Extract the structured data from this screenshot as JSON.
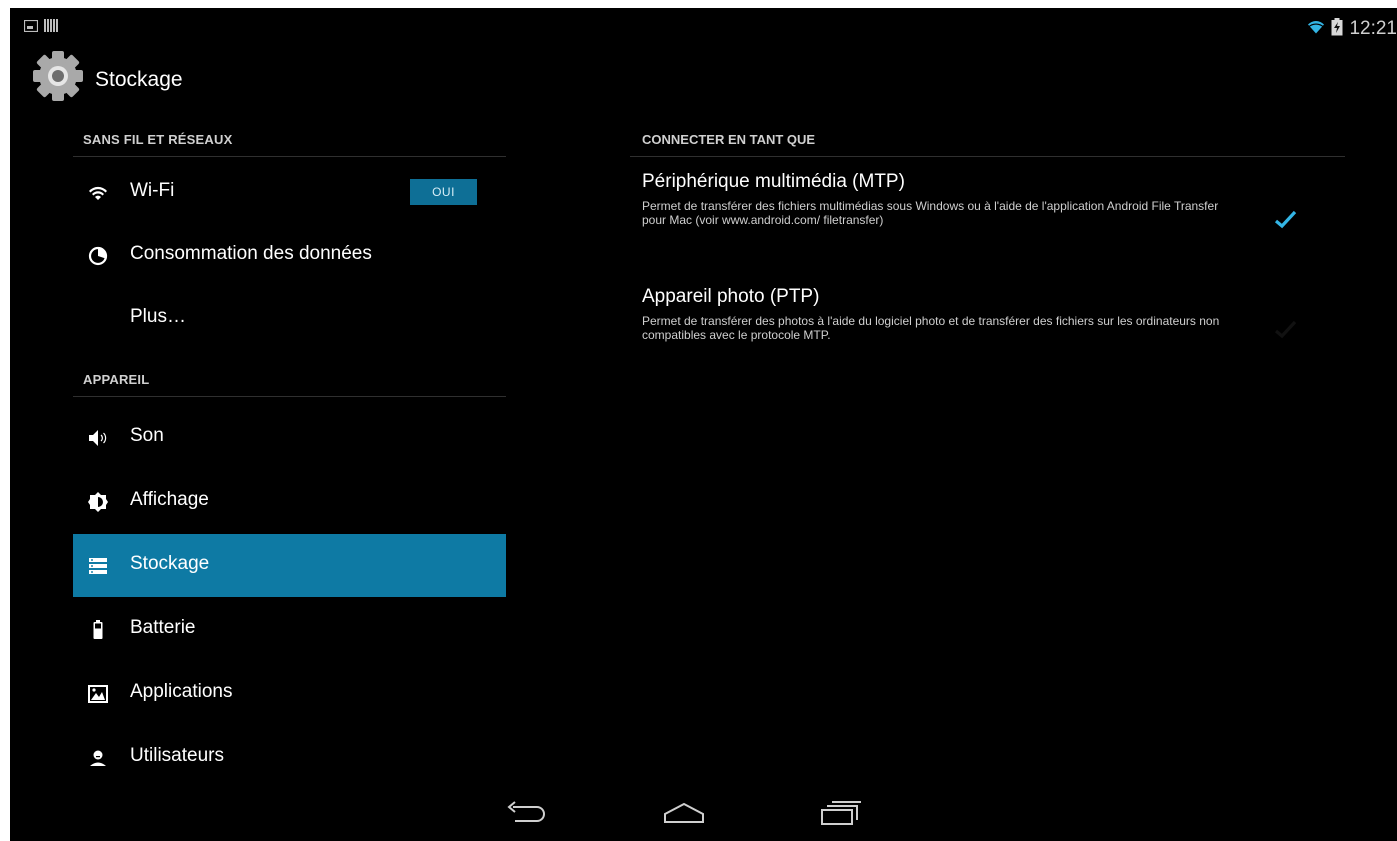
{
  "status_bar": {
    "time": "12:21",
    "left_icons": [
      "picture-notification-icon",
      "barcode-notification-icon"
    ],
    "right_icons": [
      "wifi-signal-icon",
      "battery-charging-icon"
    ]
  },
  "action_bar": {
    "title": "Stockage",
    "icon": "settings-gear-icon"
  },
  "sidebar": {
    "sections": [
      {
        "header": "SANS FIL ET RÉSEAUX",
        "items": [
          {
            "label": "Wi-Fi",
            "icon": "wifi-icon",
            "toggle": "OUI"
          },
          {
            "label": "Consommation des données",
            "icon": "data-usage-icon"
          },
          {
            "label": "Plus…",
            "icon": ""
          }
        ]
      },
      {
        "header": "APPAREIL",
        "items": [
          {
            "label": "Son",
            "icon": "volume-icon"
          },
          {
            "label": "Affichage",
            "icon": "brightness-icon"
          },
          {
            "label": "Stockage",
            "icon": "storage-icon",
            "selected": true
          },
          {
            "label": "Batterie",
            "icon": "battery-icon"
          },
          {
            "label": "Applications",
            "icon": "applications-icon"
          },
          {
            "label": "Utilisateurs",
            "icon": "user-icon"
          }
        ]
      }
    ]
  },
  "main": {
    "header": "CONNECTER EN TANT QUE",
    "options": [
      {
        "title": "Périphérique multimédia (MTP)",
        "summary": "Permet de transférer des fichiers multimédias sous Windows ou à l'aide de l'application Android File Transfer pour Mac (voir www.android.com/ filetransfer)",
        "checked": true
      },
      {
        "title": "Appareil photo (PTP)",
        "summary": "Permet de transférer des photos à l'aide du logiciel photo et de transférer des fichiers sur les ordinateurs non compatibles avec le protocole MTP.",
        "checked": false
      }
    ]
  },
  "navigation": {
    "buttons": [
      "back-icon",
      "home-icon",
      "recent-apps-icon"
    ]
  },
  "colors": {
    "accent": "#0e7aa4",
    "check": "#33b5e5",
    "background": "#000000"
  }
}
